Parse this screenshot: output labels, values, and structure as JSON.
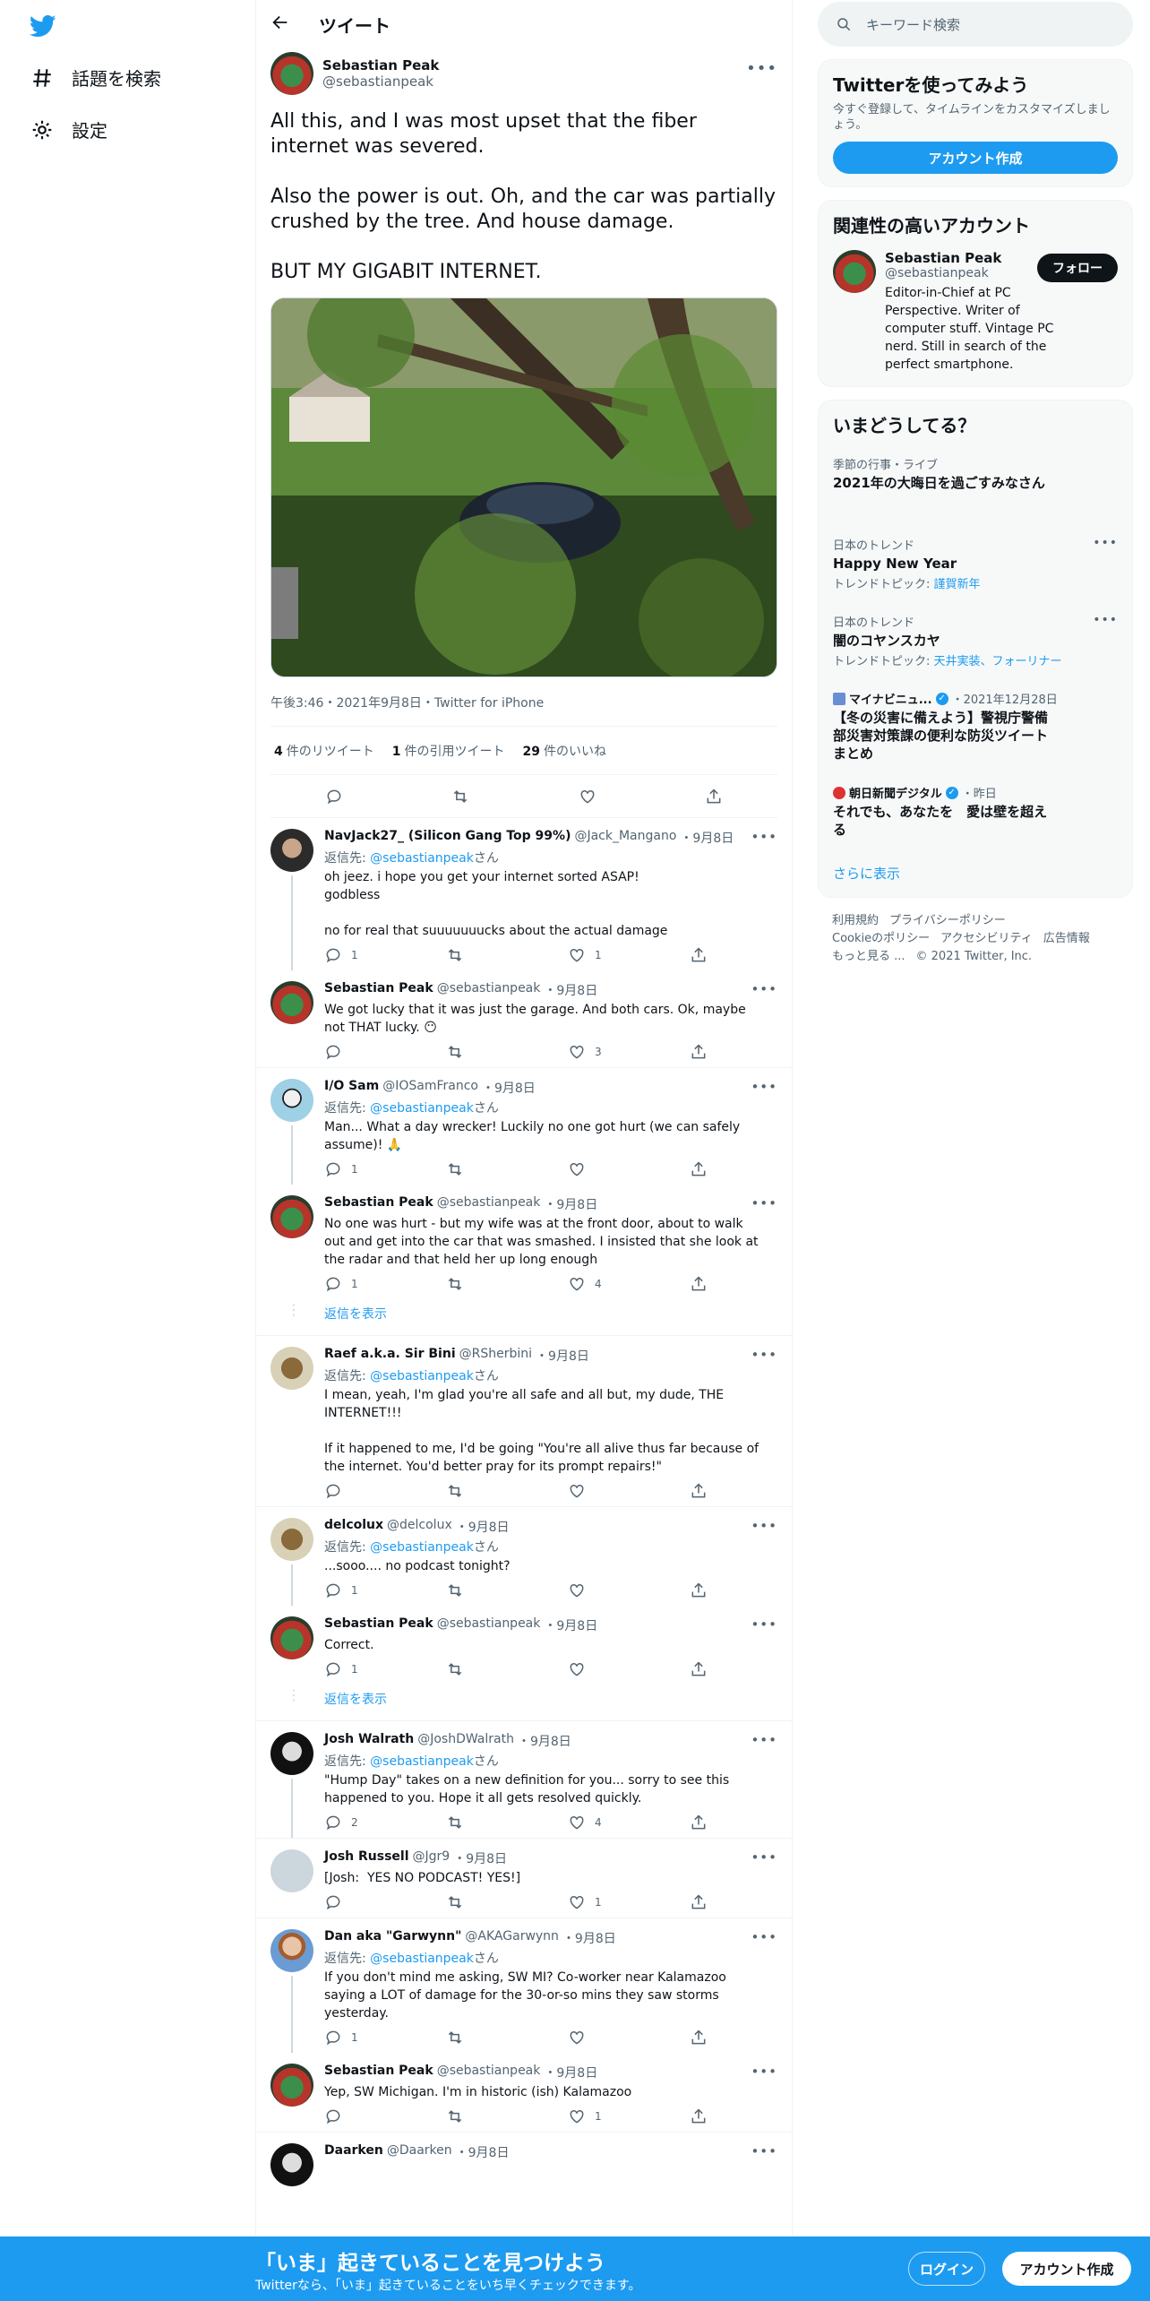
{
  "nav": {
    "explore_label": "話題を検索",
    "settings_label": "設定"
  },
  "header": {
    "title": "ツイート"
  },
  "main_tweet": {
    "name": "Sebastian Peak",
    "handle": "@sebastianpeak",
    "text": "All this, and I was most upset that the fiber internet was severed.\n\nAlso the power is out. Oh, and the car was partially crushed by the tree. And house damage.\n\nBUT MY GIGABIT INTERNET.",
    "meta": "午後3:46・2021年9月8日・Twitter for iPhone",
    "retweets": "4",
    "retweets_label": "件のリツイート",
    "quotes": "1",
    "quotes_label": "件の引用ツイート",
    "likes": "29",
    "likes_label": "件のいいね"
  },
  "replies": [
    {
      "name": "NavJack27_ (Silicon Gang Top 99%)",
      "handle": "@Jack_Mangano",
      "date": "・9月8日",
      "to_prefix": "返信先: ",
      "to": "@sebastianpeak",
      "to_suffix": "さん",
      "text": "oh jeez. i hope you get your internet sorted ASAP!\ngodbless\n\nno for real that suuuuuuucks about the actual damage",
      "replies": "1",
      "retweets": "",
      "likes": "1"
    },
    {
      "name": "Sebastian Peak",
      "handle": "@sebastianpeak",
      "date": "・9月8日",
      "text": "We got lucky that it was just the garage. And both cars. Ok, maybe not THAT lucky. 😶",
      "replies": "",
      "retweets": "",
      "likes": "3"
    },
    {
      "name": "I/O Sam",
      "handle": "@IOSamFranco",
      "date": "・9月8日",
      "to_prefix": "返信先: ",
      "to": "@sebastianpeak",
      "to_suffix": "さん",
      "text": "Man... What a day wrecker! Luckily no one got hurt (we can safely assume)! 🙏",
      "replies": "1",
      "retweets": "",
      "likes": ""
    },
    {
      "name": "Sebastian Peak",
      "handle": "@sebastianpeak",
      "date": "・9月8日",
      "text": "No one was hurt - but my wife was at the front door, about to walk out and get into the car that was smashed. I insisted that she look at the radar and that held her up long enough",
      "replies": "1",
      "retweets": "",
      "likes": "4"
    },
    {
      "name": "Raef a.k.a. Sir Bini",
      "handle": "@RSherbini",
      "date": "・9月8日",
      "to_prefix": "返信先: ",
      "to": "@sebastianpeak",
      "to_suffix": "さん",
      "text": "I mean, yeah, I'm glad you're all safe and all but, my dude, THE INTERNET!!!\n\nIf it happened to me, I'd be going \"You're all alive thus far because of the internet. You'd better pray for its prompt repairs!\"",
      "replies": "",
      "retweets": "",
      "likes": ""
    },
    {
      "name": "delcolux",
      "handle": "@delcolux",
      "date": "・9月8日",
      "to_prefix": "返信先: ",
      "to": "@sebastianpeak",
      "to_suffix": "さん",
      "text": "...sooo.... no podcast tonight?",
      "replies": "1",
      "retweets": "",
      "likes": ""
    },
    {
      "name": "Sebastian Peak",
      "handle": "@sebastianpeak",
      "date": "・9月8日",
      "text": "Correct.",
      "replies": "1",
      "retweets": "",
      "likes": ""
    },
    {
      "name": "Josh Walrath",
      "handle": "@JoshDWalrath",
      "date": "・9月8日",
      "to_prefix": "返信先: ",
      "to": "@sebastianpeak",
      "to_suffix": "さん",
      "text": "\"Hump Day\" takes on a new definition for you... sorry to see this happened to you. Hope it all gets resolved quickly.",
      "replies": "2",
      "retweets": "",
      "likes": "4"
    },
    {
      "name": "Josh Russell",
      "handle": "@Jgr9",
      "date": "・9月8日",
      "text": "[Josh:  YES NO PODCAST! YES!]",
      "replies": "",
      "retweets": "",
      "likes": "1"
    },
    {
      "name": "Dan aka \"Garwynn\"",
      "handle": "@AKAGarwynn",
      "date": "・9月8日",
      "to_prefix": "返信先: ",
      "to": "@sebastianpeak",
      "to_suffix": "さん",
      "text": "If you don't mind me asking, SW MI? Co-worker near Kalamazoo saying a LOT of damage for the 30-or-so mins they saw storms yesterday.",
      "replies": "1",
      "retweets": "",
      "likes": ""
    },
    {
      "name": "Sebastian Peak",
      "handle": "@sebastianpeak",
      "date": "・9月8日",
      "text": "Yep, SW Michigan. I'm in historic (ish) Kalamazoo",
      "replies": "",
      "retweets": "",
      "likes": "1"
    },
    {
      "name": "Daarken",
      "handle": "@Daarken",
      "date": "・9月8日",
      "text": ""
    }
  ],
  "show_replies": "返信を表示",
  "right": {
    "search_placeholder": "キーワード検索",
    "signup_card": {
      "title": "Twitterを使ってみよう",
      "sub": "今すぐ登録して、タイムラインをカスタマイズしましょう。",
      "button": "アカウント作成"
    },
    "related": {
      "title": "関連性の高いアカウント",
      "name": "Sebastian Peak",
      "handle": "@sebastianpeak",
      "bio": "Editor-in-Chief at PC Perspective. Writer of computer stuff. Vintage PC nerd. Still in search of the perfect smartphone.",
      "follow": "フォロー"
    },
    "trends": {
      "title": "いまどうしてる？",
      "items": [
        {
          "cat": "季節の行事・ライブ",
          "title": "2021年の大晦日を過ごすみなさん"
        },
        {
          "cat": "日本のトレンド",
          "title": "Happy New Year",
          "topic_prefix": "トレンドトピック: ",
          "topic": "謹賀新年"
        },
        {
          "cat": "日本のトレンド",
          "title": "闇のコヤンスカヤ",
          "topic_prefix": "トレンドトピック: ",
          "topic": "天井実装、フォーリナー"
        }
      ],
      "news": [
        {
          "src": "マイナビニュ...",
          "date": "・2021年12月28日",
          "title": "【冬の災害に備えよう】警視庁警備部災害対策課の便利な防災ツイートまとめ"
        },
        {
          "src": "朝日新聞デジタル",
          "date": "・昨日",
          "title": "それでも、あなたを　愛は壁を超える"
        }
      ],
      "show_more": "さらに表示"
    },
    "footer": [
      "利用規約",
      "プライバシーポリシー",
      "Cookieのポリシー",
      "アクセシビリティ",
      "広告情報",
      "もっと見る ...",
      "© 2021 Twitter, Inc."
    ]
  },
  "bottom": {
    "title": "「いま」起きていることを見つけよう",
    "sub": "Twitterなら、「いま」起きていることをいち早くチェックできます。",
    "login": "ログイン",
    "signup": "アカウント作成"
  },
  "colors": {
    "accent": "#1d9bf0",
    "text": "#0f1419",
    "muted": "#536471"
  }
}
